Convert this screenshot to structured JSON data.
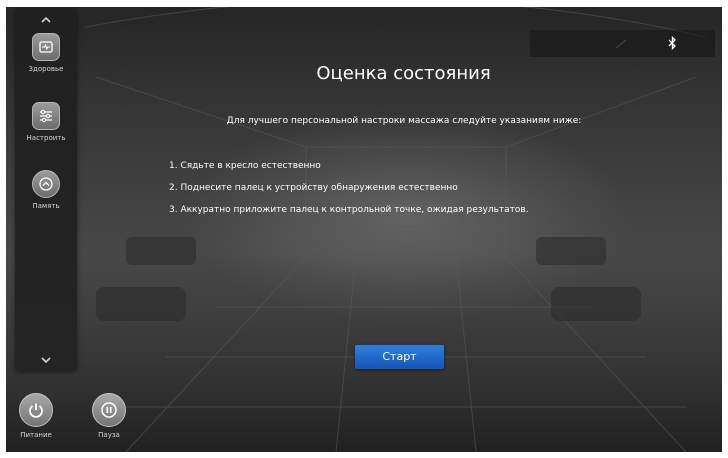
{
  "sidebar": {
    "scroll_up_icon": "chevron-up",
    "scroll_down_icon": "chevron-down",
    "items": [
      {
        "label": "Здоровье",
        "icon": "health-monitor-icon"
      },
      {
        "label": "Настроить",
        "icon": "sliders-icon"
      },
      {
        "label": "Память",
        "icon": "memory-icon"
      }
    ]
  },
  "status_bar": {
    "bluetooth_glyph": "✱"
  },
  "main": {
    "title": "Оценка состояния",
    "subtitle": "Для лучшего персональной настроки массажа следуйте указаниям ниже:",
    "instructions": [
      "1. Сядьте в кресло естественно",
      "2. Поднесите палец к устройству обнаружения естественно",
      "3. Аккуратно приложите палец к контрольной точке, ожидая результатов."
    ],
    "start_label": "Старт"
  },
  "bottom_controls": {
    "power_label": "Питание",
    "pause_label": "Пауза"
  },
  "colors": {
    "accent": "#1f66c9",
    "background": "#3a3a3a",
    "text": "#ffffff"
  }
}
